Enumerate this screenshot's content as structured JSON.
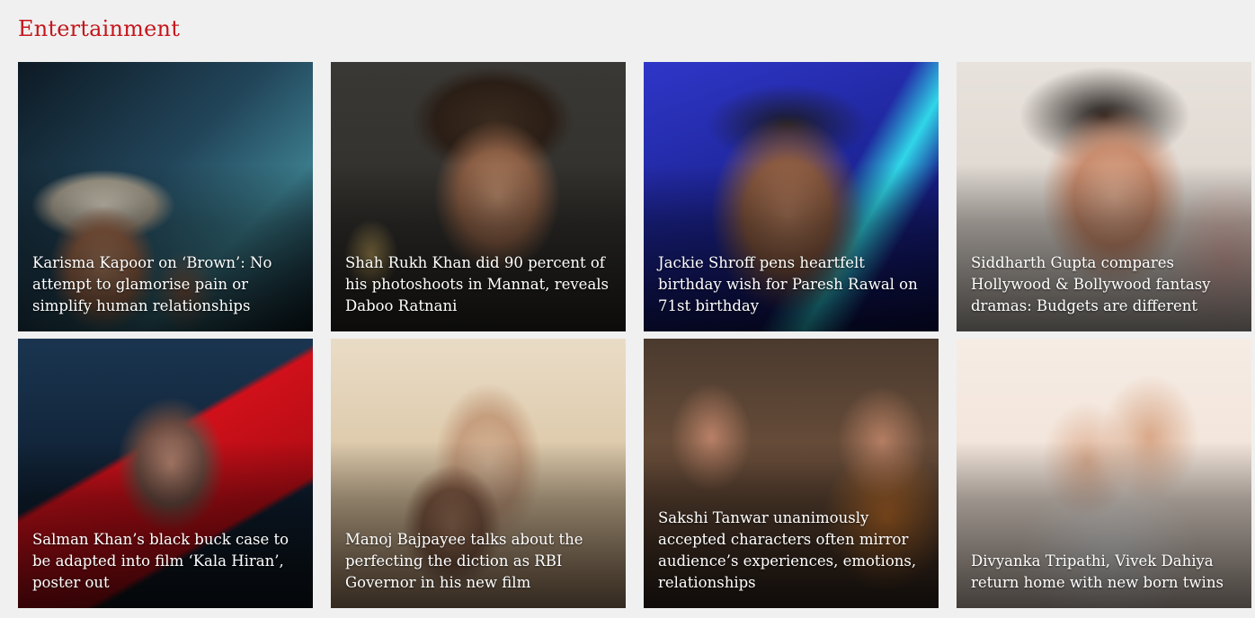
{
  "section": {
    "title": "Entertainment"
  },
  "colors": {
    "accent": "#c4161c",
    "background": "#f0f0f0",
    "headline_text": "#ffffff"
  },
  "cards": [
    {
      "headline": "Karisma Kapoor on ‘Brown’: No attempt to glamorise pain or simplify human relationships"
    },
    {
      "headline": "Shah Rukh Khan did 90 percent of his photoshoots in Mannat, reveals Daboo Ratnani"
    },
    {
      "headline": "Jackie Shroff pens heartfelt birthday wish for Paresh Rawal on 71st birthday"
    },
    {
      "headline": "Siddharth Gupta compares Hollywood & Bollywood fantasy dramas: Budgets are different"
    },
    {
      "headline": "Salman Khan’s black buck case to be adapted into film ‘Kala Hiran’, poster out"
    },
    {
      "headline": "Manoj Bajpayee talks about the perfecting the diction as RBI Governor in his new film"
    },
    {
      "headline": "Sakshi Tanwar unanimously accepted characters often mirror audience’s experiences, emotions, relationships"
    },
    {
      "headline": "Divyanka Tripathi, Vivek Dahiya return home with new born twins"
    }
  ]
}
